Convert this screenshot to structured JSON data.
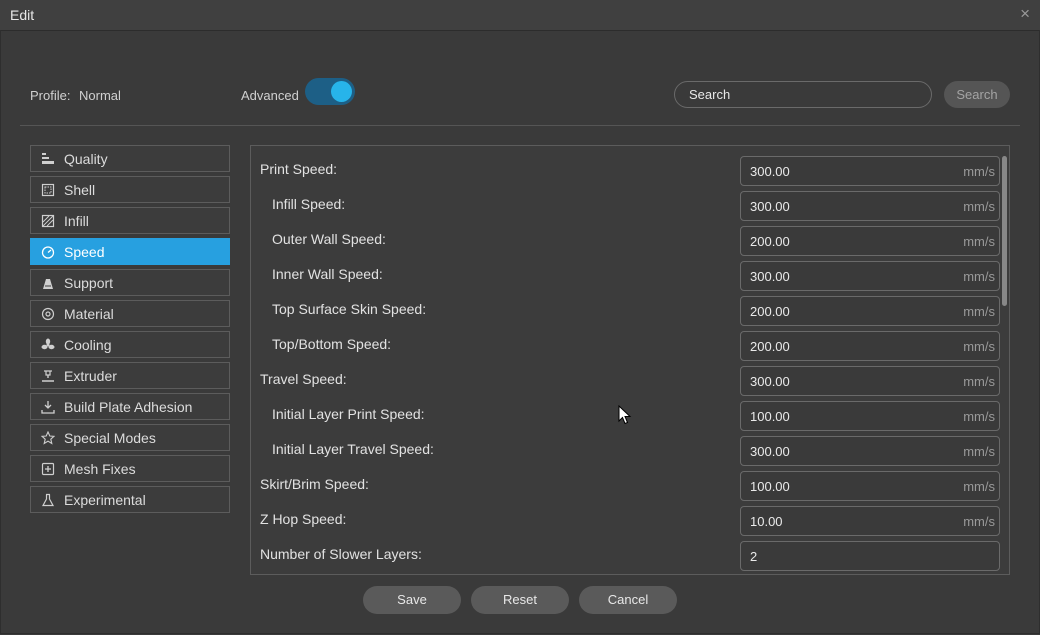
{
  "window": {
    "title": "Edit",
    "close_glyph": "×"
  },
  "profile": {
    "label": "Profile:",
    "value": "Normal"
  },
  "advanced": {
    "label": "Advanced",
    "enabled": true,
    "accent": "#27b4ea"
  },
  "search": {
    "placeholder": "Search",
    "button_label": "Search"
  },
  "sidebar": {
    "active_color": "#27a0e0",
    "items": [
      {
        "label": "Quality",
        "icon": "quality-icon",
        "active": false
      },
      {
        "label": "Shell",
        "icon": "shell-icon",
        "active": false
      },
      {
        "label": "Infill",
        "icon": "infill-icon",
        "active": false
      },
      {
        "label": "Speed",
        "icon": "speed-gauge-icon",
        "active": true
      },
      {
        "label": "Support",
        "icon": "support-icon",
        "active": false
      },
      {
        "label": "Material",
        "icon": "material-spool-icon",
        "active": false
      },
      {
        "label": "Cooling",
        "icon": "fan-icon",
        "active": false
      },
      {
        "label": "Extruder",
        "icon": "extruder-icon",
        "active": false
      },
      {
        "label": "Build Plate Adhesion",
        "icon": "build-plate-icon",
        "active": false
      },
      {
        "label": "Special Modes",
        "icon": "star-icon",
        "active": false
      },
      {
        "label": "Mesh Fixes",
        "icon": "mesh-fix-icon",
        "active": false
      },
      {
        "label": "Experimental",
        "icon": "flask-icon",
        "active": false
      }
    ]
  },
  "settings": [
    {
      "label": "Print Speed:",
      "value": "300.00",
      "unit": "mm/s",
      "indent": false
    },
    {
      "label": "Infill Speed:",
      "value": "300.00",
      "unit": "mm/s",
      "indent": true
    },
    {
      "label": "Outer Wall Speed:",
      "value": "200.00",
      "unit": "mm/s",
      "indent": true
    },
    {
      "label": "Inner Wall Speed:",
      "value": "300.00",
      "unit": "mm/s",
      "indent": true
    },
    {
      "label": "Top Surface Skin Speed:",
      "value": "200.00",
      "unit": "mm/s",
      "indent": true
    },
    {
      "label": "Top/Bottom Speed:",
      "value": "200.00",
      "unit": "mm/s",
      "indent": true
    },
    {
      "label": "Travel Speed:",
      "value": "300.00",
      "unit": "mm/s",
      "indent": false
    },
    {
      "label": "Initial Layer Print Speed:",
      "value": "100.00",
      "unit": "mm/s",
      "indent": true
    },
    {
      "label": "Initial Layer Travel Speed:",
      "value": "300.00",
      "unit": "mm/s",
      "indent": true
    },
    {
      "label": "Skirt/Brim Speed:",
      "value": "100.00",
      "unit": "mm/s",
      "indent": false
    },
    {
      "label": "Z Hop Speed:",
      "value": "10.00",
      "unit": "mm/s",
      "indent": false
    },
    {
      "label": "Number of Slower Layers:",
      "value": "2",
      "unit": "",
      "indent": false
    }
  ],
  "actions": {
    "save": "Save",
    "reset": "Reset",
    "cancel": "Cancel"
  }
}
